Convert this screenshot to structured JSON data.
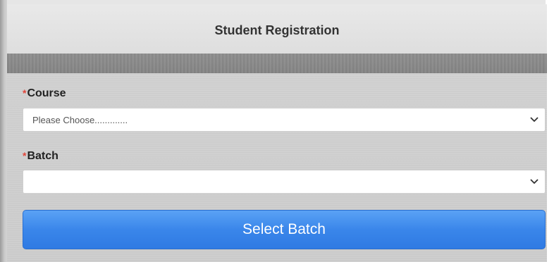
{
  "header": {
    "title": "Student Registration"
  },
  "form": {
    "required_marker": "*",
    "course": {
      "label": "Course",
      "selected_value": "Please Choose............."
    },
    "batch": {
      "label": "Batch",
      "selected_value": ""
    },
    "submit_label": "Select Batch"
  },
  "icons": {
    "dropdown": "chevron-down-icon"
  },
  "colors": {
    "button": "#3a86ea",
    "required": "#e0453a",
    "divider": "#888888"
  }
}
